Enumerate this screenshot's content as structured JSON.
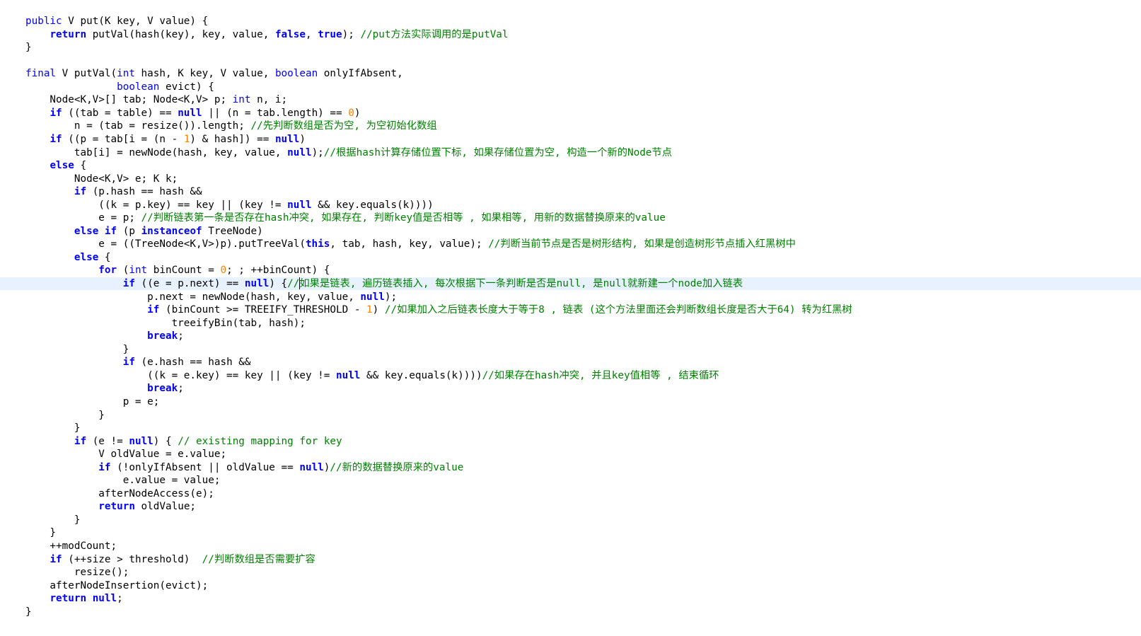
{
  "editor": {
    "current_line_index": 20,
    "colors": {
      "background": "#ffffff",
      "keyword": "#0000ff",
      "comment": "#008000",
      "number": "#ff8000",
      "text": "#000000",
      "current_line": "#e8f2fe"
    },
    "lines": [
      [
        [
          "kw",
          "public"
        ],
        [
          "t",
          " V put(K key, V value) {"
        ]
      ],
      [
        [
          "t",
          "    "
        ],
        [
          "kwb",
          "return"
        ],
        [
          "t",
          " putVal(hash(key), key, value, "
        ],
        [
          "kwb",
          "false"
        ],
        [
          "t",
          ", "
        ],
        [
          "kwb",
          "true"
        ],
        [
          "t",
          "); "
        ],
        [
          "cm",
          "//put方法实际调用的是putVal"
        ]
      ],
      [
        [
          "t",
          "}"
        ]
      ],
      [
        [
          "t",
          ""
        ]
      ],
      [
        [
          "kw",
          "final"
        ],
        [
          "t",
          " V putVal("
        ],
        [
          "kw",
          "int"
        ],
        [
          "t",
          " hash, K key, V value, "
        ],
        [
          "kw",
          "boolean"
        ],
        [
          "t",
          " onlyIfAbsent,"
        ]
      ],
      [
        [
          "t",
          "               "
        ],
        [
          "kw",
          "boolean"
        ],
        [
          "t",
          " evict) {"
        ]
      ],
      [
        [
          "t",
          "    Node<K,V>[] tab; Node<K,V> p; "
        ],
        [
          "kw",
          "int"
        ],
        [
          "t",
          " n, i;"
        ]
      ],
      [
        [
          "t",
          "    "
        ],
        [
          "kwb",
          "if"
        ],
        [
          "t",
          " ((tab = table) == "
        ],
        [
          "kwb",
          "null"
        ],
        [
          "t",
          " || (n = tab.length) == "
        ],
        [
          "num",
          "0"
        ],
        [
          "t",
          ")"
        ]
      ],
      [
        [
          "t",
          "        n = (tab = resize()).length; "
        ],
        [
          "cm",
          "//先判断数组是否为空, 为空初始化数组"
        ]
      ],
      [
        [
          "t",
          "    "
        ],
        [
          "kwb",
          "if"
        ],
        [
          "t",
          " ((p = tab[i = (n - "
        ],
        [
          "num",
          "1"
        ],
        [
          "t",
          ") & hash]) == "
        ],
        [
          "kwb",
          "null"
        ],
        [
          "t",
          ")"
        ]
      ],
      [
        [
          "t",
          "        tab[i] = newNode(hash, key, value, "
        ],
        [
          "kwb",
          "null"
        ],
        [
          "t",
          ");"
        ],
        [
          "cm",
          "//根据hash计算存储位置下标, 如果存储位置为空, 构造一个新的Node节点"
        ]
      ],
      [
        [
          "t",
          "    "
        ],
        [
          "kwb",
          "else"
        ],
        [
          "t",
          " {"
        ]
      ],
      [
        [
          "t",
          "        Node<K,V> e; K k;"
        ]
      ],
      [
        [
          "t",
          "        "
        ],
        [
          "kwb",
          "if"
        ],
        [
          "t",
          " (p.hash == hash &&"
        ]
      ],
      [
        [
          "t",
          "            ((k = p.key) == key || (key != "
        ],
        [
          "kwb",
          "null"
        ],
        [
          "t",
          " && key.equals(k))))"
        ]
      ],
      [
        [
          "t",
          "            e = p; "
        ],
        [
          "cm",
          "//判断链表第一条是否存在hash冲突, 如果存在, 判断key值是否相等 , 如果相等, 用新的数据替换原来的value"
        ]
      ],
      [
        [
          "t",
          "        "
        ],
        [
          "kwb",
          "else if"
        ],
        [
          "t",
          " (p "
        ],
        [
          "kwb",
          "instanceof"
        ],
        [
          "t",
          " TreeNode)"
        ]
      ],
      [
        [
          "t",
          "            e = ((TreeNode<K,V>)p).putTreeVal("
        ],
        [
          "kwb",
          "this"
        ],
        [
          "t",
          ", tab, hash, key, value); "
        ],
        [
          "cm",
          "//判断当前节点是否是树形结构, 如果是创造树形节点插入红黑树中"
        ]
      ],
      [
        [
          "t",
          "        "
        ],
        [
          "kwb",
          "else"
        ],
        [
          "t",
          " {"
        ]
      ],
      [
        [
          "t",
          "            "
        ],
        [
          "kwb",
          "for"
        ],
        [
          "t",
          " ("
        ],
        [
          "kw",
          "int"
        ],
        [
          "t",
          " binCount = "
        ],
        [
          "num",
          "0"
        ],
        [
          "t",
          "; ; ++binCount) {"
        ]
      ],
      [
        [
          "t",
          "                "
        ],
        [
          "kwb",
          "if"
        ],
        [
          "t",
          " ((e = p.next) == "
        ],
        [
          "kwb",
          "null"
        ],
        [
          "t",
          ") {"
        ],
        [
          "cm",
          "//如果是链表, 遍历链表插入, 每次根据下一条判断是否是null, 是null就新建一个node加入链表"
        ]
      ],
      [
        [
          "t",
          "                    p.next = newNode(hash, key, value, "
        ],
        [
          "kwb",
          "null"
        ],
        [
          "t",
          ");"
        ]
      ],
      [
        [
          "t",
          "                    "
        ],
        [
          "kwb",
          "if"
        ],
        [
          "t",
          " (binCount >= TREEIFY_THRESHOLD - "
        ],
        [
          "num",
          "1"
        ],
        [
          "t",
          ") "
        ],
        [
          "cm",
          "//如果加入之后链表长度大于等于8 , 链表 (这个方法里面还会判断数组长度是否大于64) 转为红黑树"
        ]
      ],
      [
        [
          "t",
          "                        treeifyBin(tab, hash);"
        ]
      ],
      [
        [
          "t",
          "                    "
        ],
        [
          "kwb",
          "break"
        ],
        [
          "t",
          ";"
        ]
      ],
      [
        [
          "t",
          "                }"
        ]
      ],
      [
        [
          "t",
          "                "
        ],
        [
          "kwb",
          "if"
        ],
        [
          "t",
          " (e.hash == hash &&"
        ]
      ],
      [
        [
          "t",
          "                    ((k = e.key) == key || (key != "
        ],
        [
          "kwb",
          "null"
        ],
        [
          "t",
          " && key.equals(k))))"
        ],
        [
          "cm",
          "//如果存在hash冲突, 并且key值相等 , 结束循环"
        ]
      ],
      [
        [
          "t",
          "                    "
        ],
        [
          "kwb",
          "break"
        ],
        [
          "t",
          ";"
        ]
      ],
      [
        [
          "t",
          "                p = e;"
        ]
      ],
      [
        [
          "t",
          "            }"
        ]
      ],
      [
        [
          "t",
          "        }"
        ]
      ],
      [
        [
          "t",
          "        "
        ],
        [
          "kwb",
          "if"
        ],
        [
          "t",
          " (e != "
        ],
        [
          "kwb",
          "null"
        ],
        [
          "t",
          ") { "
        ],
        [
          "cm",
          "// existing mapping for key"
        ]
      ],
      [
        [
          "t",
          "            V oldValue = e.value;"
        ]
      ],
      [
        [
          "t",
          "            "
        ],
        [
          "kwb",
          "if"
        ],
        [
          "t",
          " (!onlyIfAbsent || oldValue == "
        ],
        [
          "kwb",
          "null"
        ],
        [
          "t",
          ")"
        ],
        [
          "cm",
          "//新的数据替换原来的value"
        ]
      ],
      [
        [
          "t",
          "                e.value = value;"
        ]
      ],
      [
        [
          "t",
          "            afterNodeAccess(e);"
        ]
      ],
      [
        [
          "t",
          "            "
        ],
        [
          "kwb",
          "return"
        ],
        [
          "t",
          " oldValue;"
        ]
      ],
      [
        [
          "t",
          "        }"
        ]
      ],
      [
        [
          "t",
          "    }"
        ]
      ],
      [
        [
          "t",
          "    ++modCount;"
        ]
      ],
      [
        [
          "t",
          "    "
        ],
        [
          "kwb",
          "if"
        ],
        [
          "t",
          " (++size > threshold)  "
        ],
        [
          "cm",
          "//判断数组是否需要扩容"
        ]
      ],
      [
        [
          "t",
          "        resize();"
        ]
      ],
      [
        [
          "t",
          "    afterNodeInsertion(evict);"
        ]
      ],
      [
        [
          "t",
          "    "
        ],
        [
          "kwb",
          "return"
        ],
        [
          "t",
          " "
        ],
        [
          "kwb",
          "null"
        ],
        [
          "t",
          ";"
        ]
      ],
      [
        [
          "t",
          "}"
        ]
      ]
    ]
  }
}
